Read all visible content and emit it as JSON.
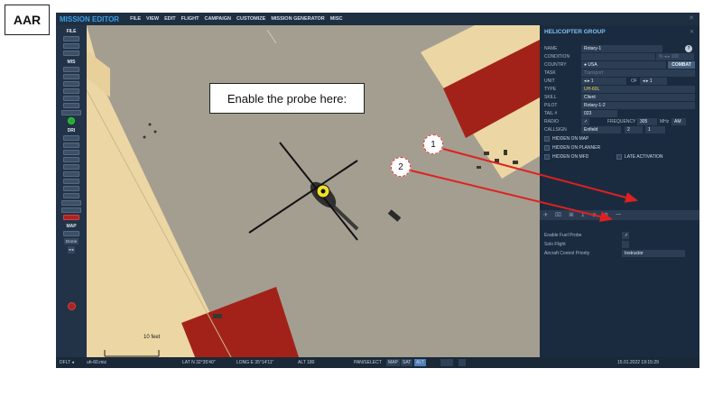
{
  "tag": "AAR",
  "callout": "Enable the probe here:",
  "markers": [
    "1",
    "2"
  ],
  "menubar": {
    "title": "MISSION EDITOR",
    "items": [
      "FILE",
      "VIEW",
      "EDIT",
      "FLIGHT",
      "CAMPAIGN",
      "CUSTOMIZE",
      "MISSION GENERATOR",
      "MISC"
    ]
  },
  "toolbar": {
    "file": "FILE",
    "mis": "MIS",
    "dr": "DRI",
    "map": "MAP",
    "drone": "Drone",
    "arrows": "▸◂"
  },
  "map": {
    "scale": "10 feet"
  },
  "panel": {
    "title": "HELICOPTER GROUP",
    "fields": {
      "name_k": "NAME",
      "name_v": "Rotary-1",
      "help": "?",
      "condition_k": "CONDITION",
      "condition_pct": "% ◂ ▸ 100",
      "country_k": "COUNTRY",
      "country_v": "● USA",
      "combat": "COMBAT",
      "task_k": "TASK",
      "task_v": "Transport",
      "unit_k": "UNIT",
      "unit_v": "◂ ▸ 1",
      "of": "OF",
      "unit_of": "◂ ▸ 1",
      "type_k": "TYPE",
      "type_v": "UH-60L",
      "skill_k": "SKILL",
      "skill_v": "Client",
      "pilot_k": "PILOT",
      "pilot_v": "Rotary-1-2",
      "tail_k": "TAIL #",
      "tail_v": "023",
      "radio_k": "RADIO",
      "radio_v": "✓",
      "freq_k": "FREQUENCY",
      "freq_v": "305",
      "mhz": "MHz",
      "am": "AM",
      "callsign_k": "CALLSIGN",
      "callsign_v": "Enfield",
      "cs2": "2",
      "cs1": "1"
    },
    "checks": {
      "hidden_map": "HIDDEN ON MAP",
      "hidden_planner": "HIDDEN ON PLANNER",
      "hidden_mfd": "HIDDEN ON MFD",
      "late": "LATE ACTIVATION"
    },
    "tabs": [
      "✈",
      "⌧",
      "⌘",
      "Σ",
      "⊘",
      "⚙",
      "···"
    ],
    "props": {
      "probe_k": "Enable Fuel Probe",
      "probe_v": "✓",
      "solo_k": "Solo Flight",
      "priority_k": "Aircraft Control Priority",
      "priority_v": "Instructor"
    }
  },
  "status": {
    "dflt": "DFLT ◂",
    "file": "uh-60.miz",
    "lat": "LAT  N 32°35'40\"",
    "long": "LONG  E 35°14'11\"",
    "alt": "ALT  180",
    "pansel": "PAN/SELECT",
    "map": "MAP",
    "sat": "SAT",
    "alt2": "ALT",
    "datetime": "15.01.2022 19:15:29"
  }
}
